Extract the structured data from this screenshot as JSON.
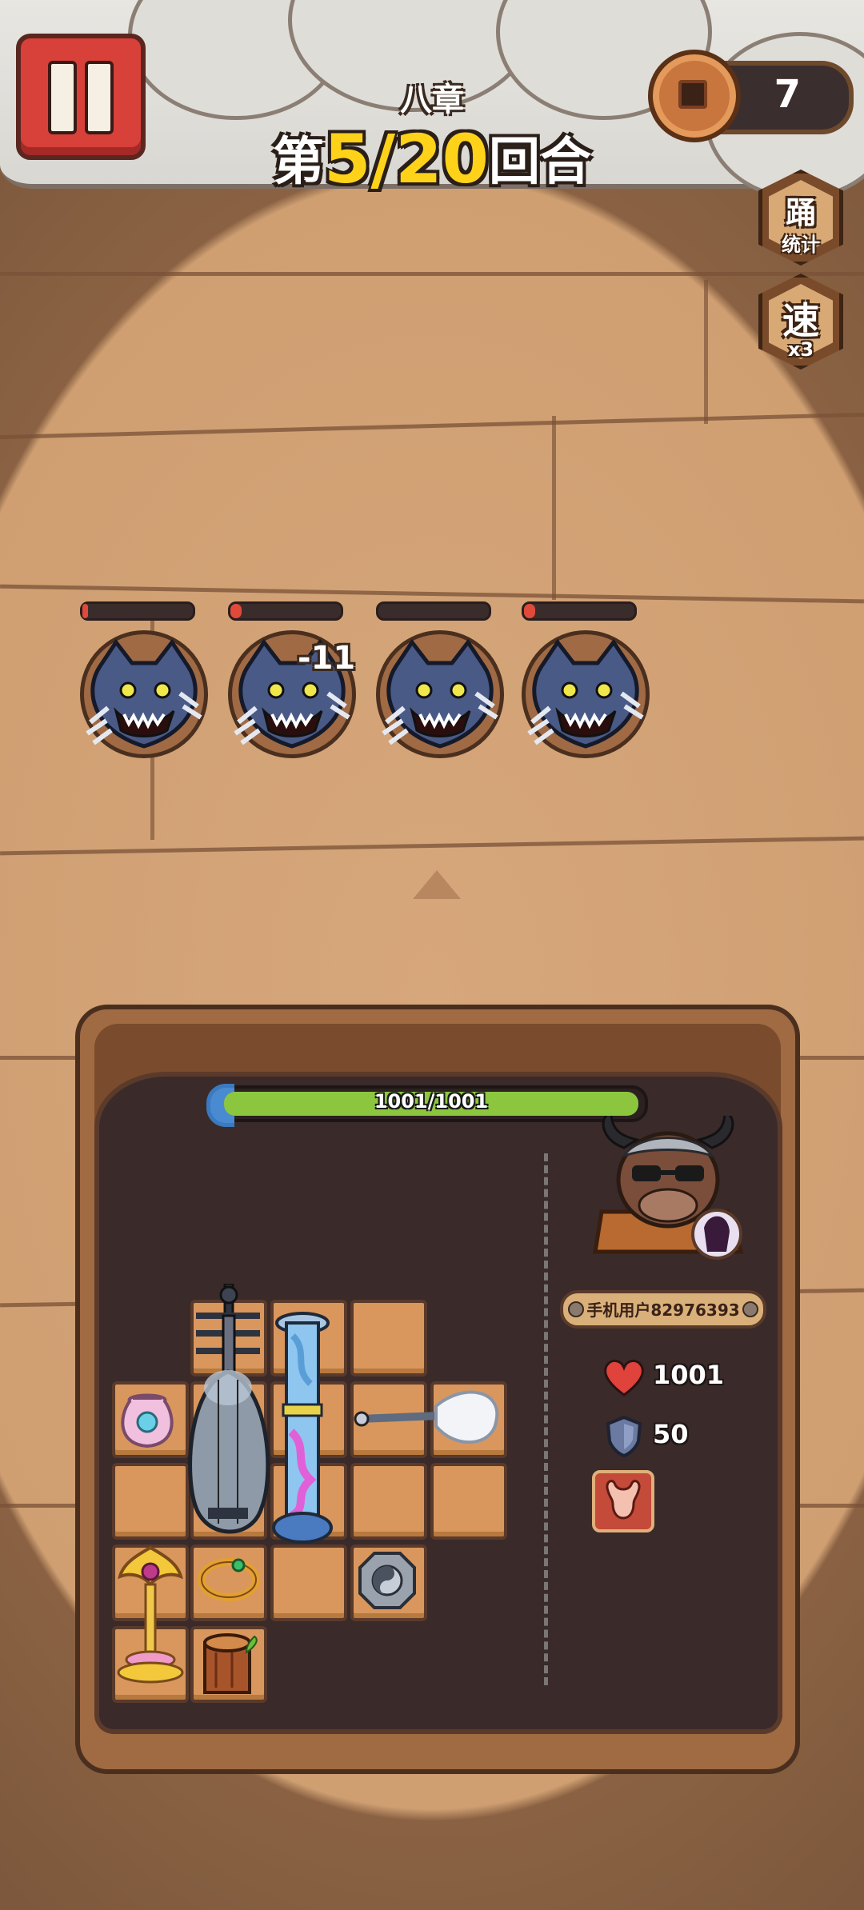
{
  "hud": {
    "chapter": "八章",
    "round_prefix": "第",
    "round_current": "5",
    "round_sep": "/",
    "round_total": "20",
    "round_suffix": "回合",
    "coins": "7",
    "stats_button": {
      "icon": "踊",
      "label": "统计"
    },
    "speed_button": {
      "icon": "速",
      "label": "x3"
    }
  },
  "battle": {
    "enemies": [
      {
        "name": "werewolf",
        "hp_fraction": 0.05
      },
      {
        "name": "werewolf",
        "hp_fraction": 0.1
      },
      {
        "name": "werewolf",
        "hp_fraction": 0.0
      },
      {
        "name": "werewolf",
        "hp_fraction": 0.1
      }
    ],
    "damage_popup": "-11"
  },
  "board": {
    "hp_text": "1001/1001",
    "hp_fraction": 1.0,
    "items": [
      "pipa-lute-icon",
      "pillar-staff-icon",
      "fan-whisk-icon",
      "jade-pouch-icon",
      "golden-lotus-icon",
      "jade-bracelet-icon",
      "taiji-coin-icon",
      "wood-stump-icon"
    ]
  },
  "player": {
    "name": "手机用户82976393",
    "hp": "1001",
    "armor": "50",
    "skill_icon": "bull-skill-icon"
  },
  "colors": {
    "hp_green": "#8cc63f",
    "enemy_hp_red": "#e04a3a",
    "round_yellow": "#ffd21a",
    "pause_red": "#d8403a"
  }
}
